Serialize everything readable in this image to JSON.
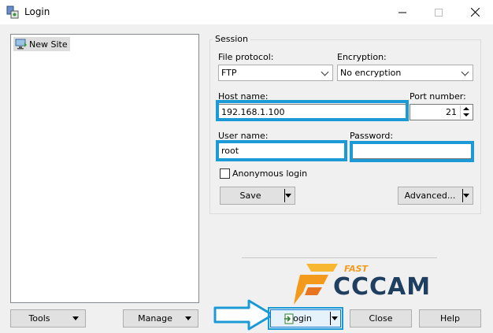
{
  "window": {
    "title": "Login"
  },
  "site_tree": {
    "items": [
      {
        "label": "New Site"
      }
    ]
  },
  "left_buttons": {
    "tools_label": "Tools",
    "manage_label": "Manage"
  },
  "session": {
    "legend": "Session",
    "file_protocol": {
      "label": "File protocol:",
      "value": "FTP"
    },
    "encryption": {
      "label": "Encryption:",
      "value": "No encryption"
    },
    "host_name": {
      "label": "Host name:",
      "value": "192.168.1.100"
    },
    "port_number": {
      "label": "Port number:",
      "value": "21"
    },
    "user_name": {
      "label": "User name:",
      "value": "root"
    },
    "password": {
      "label": "Password:",
      "value": ""
    },
    "anonymous_login": {
      "label": "Anonymous login",
      "checked": false
    },
    "save_label": "Save",
    "advanced_label": "Advanced..."
  },
  "bottom_buttons": {
    "login_label": "Login",
    "close_label": "Close",
    "help_label": "Help"
  },
  "brand": {
    "small": "FAST",
    "name": "CCCAM"
  },
  "colors": {
    "highlight": "#1c9ad6",
    "brand_orange": "#f39a1d",
    "brand_navy": "#1f3f60"
  },
  "icons": [
    "app-icon",
    "computer-icon",
    "login-icon",
    "chevron-down-icon",
    "minimize-icon",
    "maximize-icon",
    "close-icon"
  ]
}
